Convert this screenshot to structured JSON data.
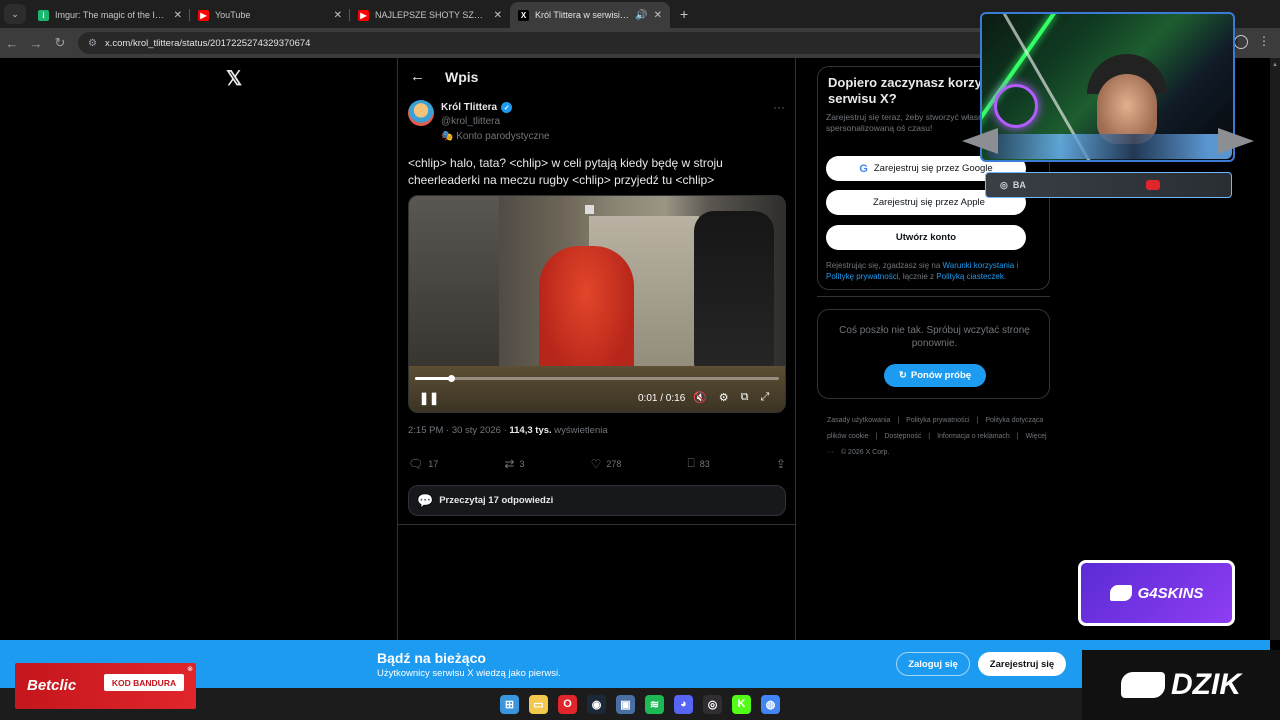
{
  "browser": {
    "tabs": [
      {
        "title": "Imgur: The magic of the Interne",
        "favicon_color": "#1bb76e",
        "favicon": "i"
      },
      {
        "title": "YouTube",
        "favicon_color": "#ff0000",
        "favicon": "▶"
      },
      {
        "title": "NAJLEPSZE SHOTY SZELIEGO W",
        "favicon_color": "#ff0000",
        "favicon": "▶"
      },
      {
        "title": "Król Tlittera w serwisie X: „K",
        "favicon_color": "#000000",
        "favicon": "X",
        "active": true
      }
    ],
    "address": "x.com/krol_tlittera/status/2017225274329370674",
    "new_tab": "+",
    "close_glyph": "✕"
  },
  "page": {
    "x_logo": "𝕏",
    "column_title": "Wpis",
    "author_name": "Król Tlittera",
    "author_handle": "@krol_tlittera",
    "parody_label": "🎭 Konto parodystyczne",
    "tweet_text": "<chlip> halo, tata? <chlip> w celi pytają kiedy będę w stroju cheerleaderki na meczu rugby <chlip> przyjedź tu <chlip>",
    "video": {
      "time": "0:01 / 0:16",
      "progress": 0.1
    },
    "timestamp": "2:15 PM · 30 sty 2026 · ",
    "views_count": "114,3 tys.",
    "views_label": " wyświetlenia",
    "actions": {
      "replies": "17",
      "reposts": "3",
      "likes": "278",
      "bookmarks": "83"
    },
    "read_replies": "Przeczytaj 17 odpowiedzi"
  },
  "sidebar": {
    "signup_title": "Dopiero zaczynasz korzystać z serwisu X?",
    "signup_sub": "Zarejestruj się teraz, żeby stworzyć własną spersonalizowaną oś czasu!",
    "google_btn": "Zarejestruj się przez Google",
    "apple_btn": "Zarejestruj się przez Apple",
    "create_btn": "Utwórz konto",
    "terms_prefix": "Rejestrując się, zgadzasz się na ",
    "terms_link1": "Warunki korzystania",
    "terms_and": " i ",
    "terms_link2": "Politykę prywatności",
    "terms_mid": ", łącznie z ",
    "terms_link3": "Polityką ciasteczek",
    "terms_end": ".",
    "error_text": "Coś poszło nie tak. Spróbuj wczytać stronę ponownie.",
    "retry_btn": "Ponów próbę",
    "footer": [
      "Zasady użytkowania",
      "|",
      "Polityka prywatności",
      "|",
      "Polityka dotycząca plików cookie",
      "|",
      "Dostępność",
      "|",
      "Informacja o reklamach",
      "|",
      "Więcej ···",
      "© 2026 X Corp."
    ]
  },
  "bottom_bar": {
    "title": "Bądź na bieżąco",
    "subtitle": "Użytkownicy serwisu X wiedzą jako pierwsi.",
    "login": "Zaloguj się",
    "register": "Zarejestruj się"
  },
  "overlays": {
    "social_handle": "BA",
    "g4_label": "G4SKINS",
    "dzik_label": "DZIK",
    "betclic_name": "Betclic",
    "betclic_code": "KOD  BANDURA"
  },
  "taskbar": [
    {
      "icon": "windows-icon",
      "color": "#3a96dd",
      "glyph": "⊞"
    },
    {
      "icon": "file-explorer-icon",
      "color": "#f2c94c",
      "glyph": "▭"
    },
    {
      "icon": "opera-icon",
      "color": "#e0262b",
      "glyph": "O"
    },
    {
      "icon": "steam-icon",
      "color": "#1b2838",
      "glyph": "◉"
    },
    {
      "icon": "monitor-icon",
      "color": "#4a6fa5",
      "glyph": "▣"
    },
    {
      "icon": "spotify-icon",
      "color": "#1db954",
      "glyph": "≋"
    },
    {
      "icon": "discord-icon",
      "color": "#5865f2",
      "glyph": "◕"
    },
    {
      "icon": "obs-icon",
      "color": "#302e31",
      "glyph": "◎"
    },
    {
      "icon": "kick-icon",
      "color": "#53fc18",
      "glyph": "K"
    },
    {
      "icon": "chrome-icon",
      "color": "#4285f4",
      "glyph": "◍"
    }
  ]
}
